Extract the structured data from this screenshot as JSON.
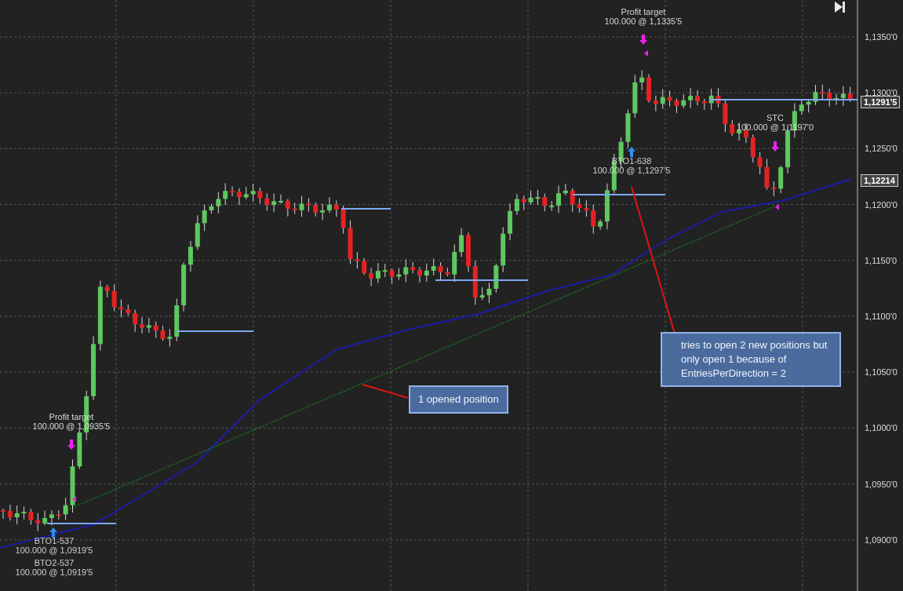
{
  "y_axis": {
    "labels": [
      "1,1350'0",
      "1,1300'0",
      "1,1250'0",
      "1,1200'0",
      "1,1150'0",
      "1,1100'0",
      "1,1050'0",
      "1,1000'0",
      "1,0950'0",
      "1,0900'0"
    ]
  },
  "price_tags": [
    {
      "kind": "last",
      "text": "1,1291'5"
    },
    {
      "kind": "indicator",
      "text": "1,12214"
    }
  ],
  "trade_labels": [
    {
      "kind": "exit",
      "title": "Profit target",
      "detail": "100.000 @ 1,0935'5"
    },
    {
      "kind": "entry",
      "title": "BTO1-537",
      "detail": "100.000 @ 1,0919'5"
    },
    {
      "kind": "entry",
      "title": "BTO2-537",
      "detail": "100.000 @ 1,0919'5"
    },
    {
      "kind": "exit",
      "title": "Profit target",
      "detail": "100.000 @ 1,1335'5"
    },
    {
      "kind": "entry",
      "title": "BTO1-638",
      "detail": "100.000 @ 1,1297'5"
    },
    {
      "kind": "exit",
      "title": "STC",
      "detail": "100.000 @ 1,1197'0"
    }
  ],
  "callouts": [
    {
      "text": "1 opened position"
    },
    {
      "text": "tries to open 2 new positions but only open 1 because of EntriesPerDirection = 2"
    }
  ]
}
